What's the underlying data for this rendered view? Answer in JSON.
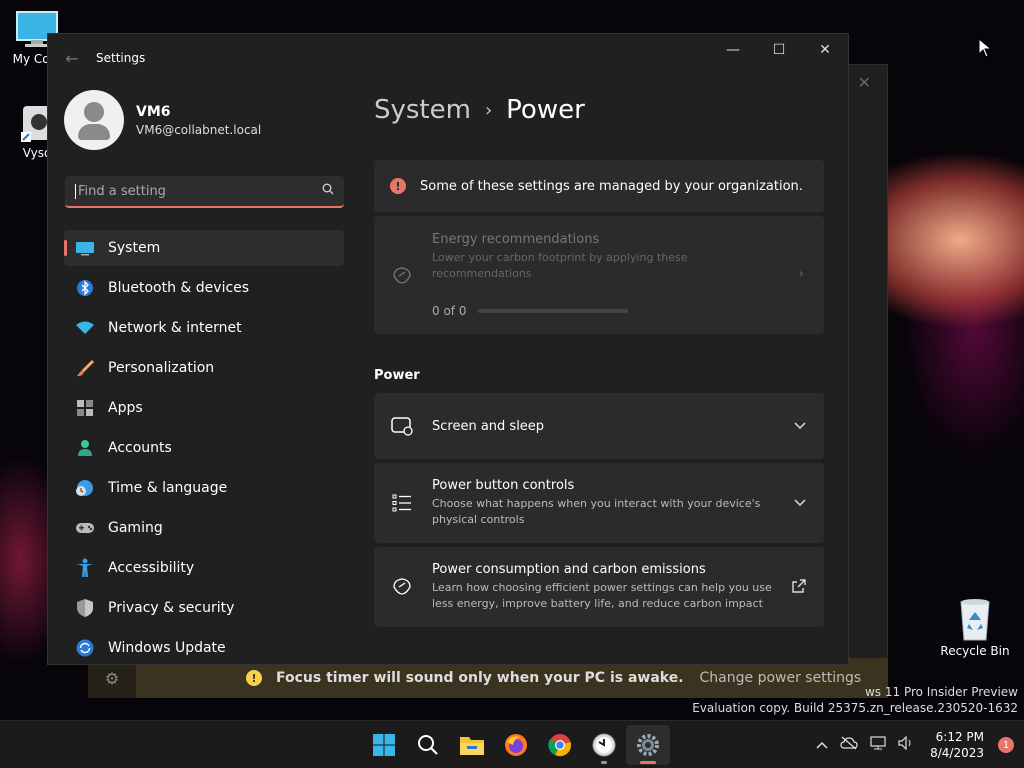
{
  "desktop": {
    "icons": [
      {
        "label": "My Com"
      },
      {
        "label": "Vyso"
      },
      {
        "label": "Recycle Bin"
      }
    ],
    "watermark_line1": "ws 11 Pro Insider Preview",
    "watermark_line2": "Evaluation copy. Build 25375.zn_release.230520-1632"
  },
  "focus": {
    "message": "Focus timer will sound only when your PC is awake.",
    "link": "Change power settings"
  },
  "window": {
    "title": "Settings",
    "minimize": "—",
    "maximize": "☐",
    "close": "✕"
  },
  "profile": {
    "name": "VM6",
    "email": "VM6@collabnet.local"
  },
  "search": {
    "placeholder": "Find a setting"
  },
  "nav": [
    {
      "label": "System",
      "icon": "system-icon",
      "active": true
    },
    {
      "label": "Bluetooth & devices",
      "icon": "bluetooth-icon"
    },
    {
      "label": "Network & internet",
      "icon": "wifi-icon"
    },
    {
      "label": "Personalization",
      "icon": "brush-icon"
    },
    {
      "label": "Apps",
      "icon": "apps-icon"
    },
    {
      "label": "Accounts",
      "icon": "person-icon"
    },
    {
      "label": "Time & language",
      "icon": "globe-clock-icon"
    },
    {
      "label": "Gaming",
      "icon": "gamepad-icon"
    },
    {
      "label": "Accessibility",
      "icon": "accessibility-icon"
    },
    {
      "label": "Privacy & security",
      "icon": "shield-icon"
    },
    {
      "label": "Windows Update",
      "icon": "update-icon"
    }
  ],
  "main": {
    "breadcrumb_parent": "System",
    "breadcrumb_sep": "›",
    "breadcrumb_current": "Power",
    "managed_notice": "Some of these settings are managed by your organization.",
    "energy": {
      "title": "Energy recommendations",
      "description": "Lower your carbon footprint by applying these recommendations",
      "progress_text": "0 of 0",
      "progress": 0
    },
    "section_title": "Power",
    "cards": [
      {
        "title": "Screen and sleep",
        "description": "",
        "icon": "screen-sleep-icon",
        "action": "chevron-down-icon"
      },
      {
        "title": "Power button controls",
        "description": "Choose what happens when you interact with your device's physical controls",
        "icon": "list-icon",
        "action": "chevron-down-icon"
      },
      {
        "title": "Power consumption and carbon emissions",
        "description": "Learn how choosing efficient power settings can help you use less energy, improve battery life, and reduce carbon impact",
        "icon": "leaf-icon",
        "action": "external-link-icon"
      }
    ]
  },
  "taskbar": {
    "time": "6:12 PM",
    "date": "8/4/2023",
    "notification_count": "1"
  },
  "colors": {
    "accent": "#e8756a",
    "background": "#202020",
    "card": "#2b2b2b"
  }
}
